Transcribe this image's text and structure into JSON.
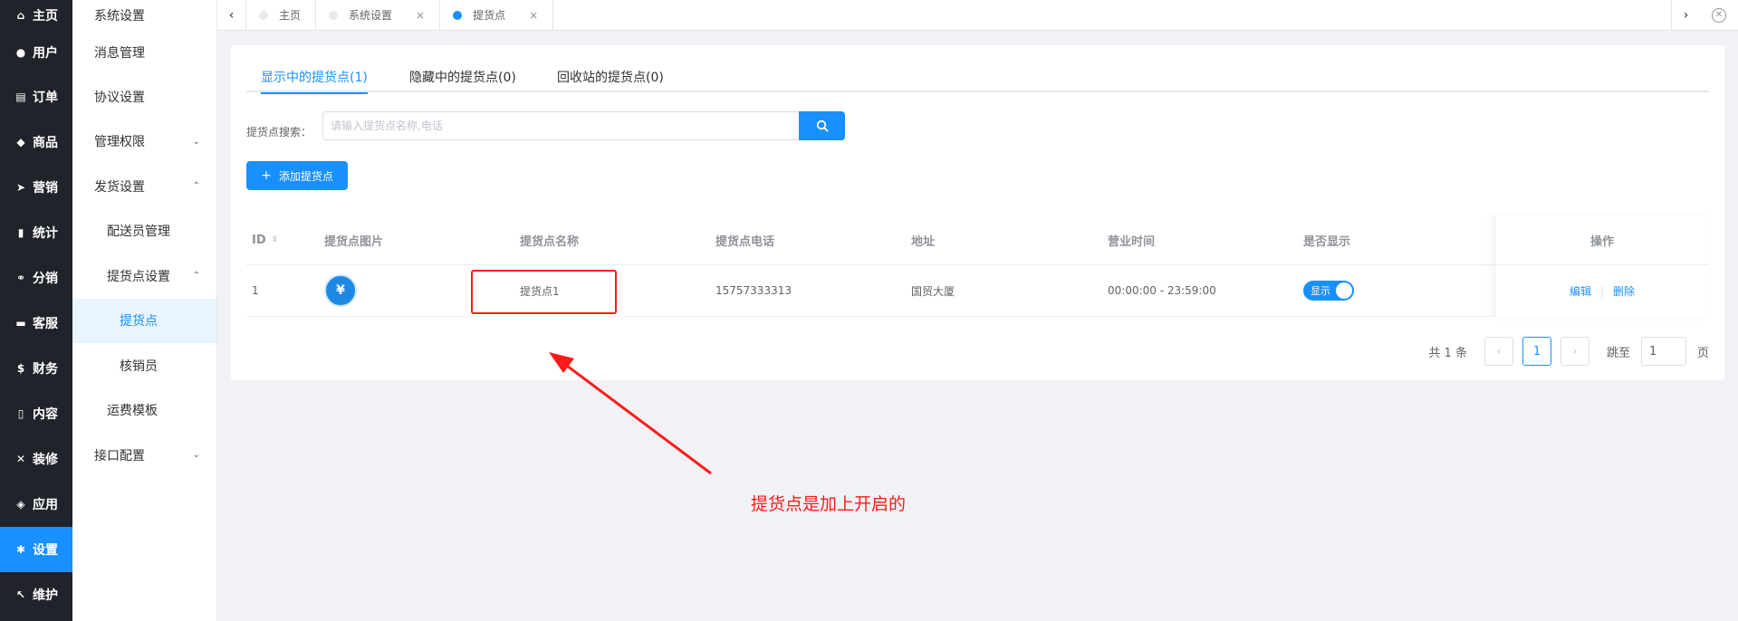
{
  "nav": {
    "items": [
      {
        "label": "主页",
        "icon": "home-icon",
        "glyph": "⌂"
      },
      {
        "label": "用户",
        "icon": "user-icon",
        "glyph": "●"
      },
      {
        "label": "订单",
        "icon": "cart-icon",
        "glyph": "▤"
      },
      {
        "label": "商品",
        "icon": "basket-icon",
        "glyph": "◆"
      },
      {
        "label": "营销",
        "icon": "send-icon",
        "glyph": "➤"
      },
      {
        "label": "统计",
        "icon": "bar-chart-icon",
        "glyph": "▮"
      },
      {
        "label": "分销",
        "icon": "share-icon",
        "glyph": "⚭"
      },
      {
        "label": "客服",
        "icon": "chat-icon",
        "glyph": "▬"
      },
      {
        "label": "财务",
        "icon": "dollar-icon",
        "glyph": "$"
      },
      {
        "label": "内容",
        "icon": "book-icon",
        "glyph": "▯"
      },
      {
        "label": "装修",
        "icon": "tools-icon",
        "glyph": "✕"
      },
      {
        "label": "应用",
        "icon": "cube-icon",
        "glyph": "◈"
      },
      {
        "label": "设置",
        "icon": "gear-icon",
        "glyph": "✱"
      },
      {
        "label": "维护",
        "icon": "wrench-icon",
        "glyph": "↖"
      }
    ]
  },
  "submenu": {
    "items": [
      {
        "label": "系统设置"
      },
      {
        "label": "消息管理"
      },
      {
        "label": "协议设置"
      },
      {
        "label": "管理权限",
        "chevron": "⌄"
      },
      {
        "label": "发货设置",
        "chevron": "⌃"
      },
      {
        "label": "配送员管理"
      },
      {
        "label": "提货点设置",
        "chevron": "⌃"
      },
      {
        "label": "提货点"
      },
      {
        "label": "核销员"
      },
      {
        "label": "运费模板"
      },
      {
        "label": "接口配置",
        "chevron": "⌄"
      }
    ]
  },
  "tabs": {
    "items": [
      {
        "label": "主页"
      },
      {
        "label": "系统设置",
        "close": "×"
      },
      {
        "label": "提货点",
        "close": "×"
      }
    ],
    "prev": "‹",
    "next": "›",
    "close_all": "✕"
  },
  "subtabs": [
    {
      "label": "显示中的提货点(1)"
    },
    {
      "label": "隐藏中的提货点(0)"
    },
    {
      "label": "回收站的提货点(0)"
    }
  ],
  "search": {
    "label": "提货点搜索：",
    "placeholder": "请输入提货点名称,电话",
    "value": ""
  },
  "add_button": {
    "label": "添加提货点",
    "plus": "+"
  },
  "table": {
    "columns": [
      "ID",
      "提货点图片",
      "提货点名称",
      "提货点电话",
      "地址",
      "营业时间",
      "是否显示",
      "操作"
    ],
    "sort_icon": "⇕",
    "rows": [
      {
        "id": "1",
        "image_glyph": "¥",
        "name": "提货点1",
        "phone": "15757333313",
        "address": "国贸大厦",
        "hours": "00:00:00 - 23:59:00",
        "visible_label": "显示",
        "edit": "编辑",
        "delete": "删除",
        "sep": "|"
      }
    ]
  },
  "pagination": {
    "total": "共 1 条",
    "prev": "‹",
    "page": "1",
    "next": "›",
    "jump_label": "跳至",
    "jump_value": "1",
    "page_suffix": "页"
  },
  "annotation": {
    "text": "提货点是加上开启的",
    "color": "#ff1a1a"
  },
  "colors": {
    "accent": "#1890ff",
    "nav_bg": "#20232a"
  }
}
